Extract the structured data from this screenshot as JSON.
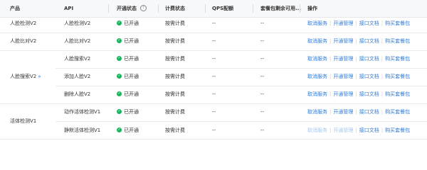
{
  "header": {
    "product": "产品",
    "api": "API",
    "status": "开通状态",
    "billing": "计费状态",
    "qps": "QPS配额",
    "package": "套餐包剩余可用...",
    "ops": "操作"
  },
  "icons": {
    "status_check": "✓",
    "expand": "»",
    "help": "?"
  },
  "colors": {
    "enabled": "#18b55c",
    "link": "#2f7bd9",
    "link_disabled": "#a9c6ee"
  },
  "products": [
    "人脸检测V2",
    "人脸比对V2",
    "人脸搜索V2",
    "活体检测V1"
  ],
  "rows": [
    {
      "api": "人脸检测V2",
      "status": "已开通",
      "billing": "按需计费",
      "qps": "--",
      "package": "--",
      "actions": [
        "取消服务",
        "开通管理",
        "接口文档",
        "购买套餐包"
      ]
    },
    {
      "api": "人脸比对V2",
      "status": "已开通",
      "billing": "按需计费",
      "qps": "--",
      "package": "--",
      "actions": [
        "取消服务",
        "开通管理",
        "接口文档",
        "购买套餐包"
      ]
    },
    {
      "api": "人脸搜索V2",
      "status": "已开通",
      "billing": "按需计费",
      "qps": "--",
      "package": "--",
      "actions": [
        "取消服务",
        "开通管理",
        "接口文档",
        "购买套餐包"
      ]
    },
    {
      "api": "添加人脸V2",
      "status": "已开通",
      "billing": "按需计费",
      "qps": "--",
      "package": "--",
      "actions": [
        "取消服务",
        "开通管理",
        "接口文档",
        "购买套餐包"
      ]
    },
    {
      "api": "删除人脸V2",
      "status": "已开通",
      "billing": "按需计费",
      "qps": "--",
      "package": "--",
      "actions": [
        "取消服务",
        "开通管理",
        "接口文档",
        "购买套餐包"
      ]
    },
    {
      "api": "动作活体检测V1",
      "status": "已开通",
      "billing": "按需计费",
      "qps": "--",
      "package": "--",
      "actions": [
        "取消服务",
        "开通管理",
        "接口文档",
        "购买套餐包"
      ]
    },
    {
      "api": "静默活体检测V1",
      "status": "已开通",
      "billing": "按需计费",
      "qps": "--",
      "package": "--",
      "actions": [
        "取消服务",
        "开通管理",
        "接口文档",
        "购买套餐包"
      ]
    }
  ]
}
